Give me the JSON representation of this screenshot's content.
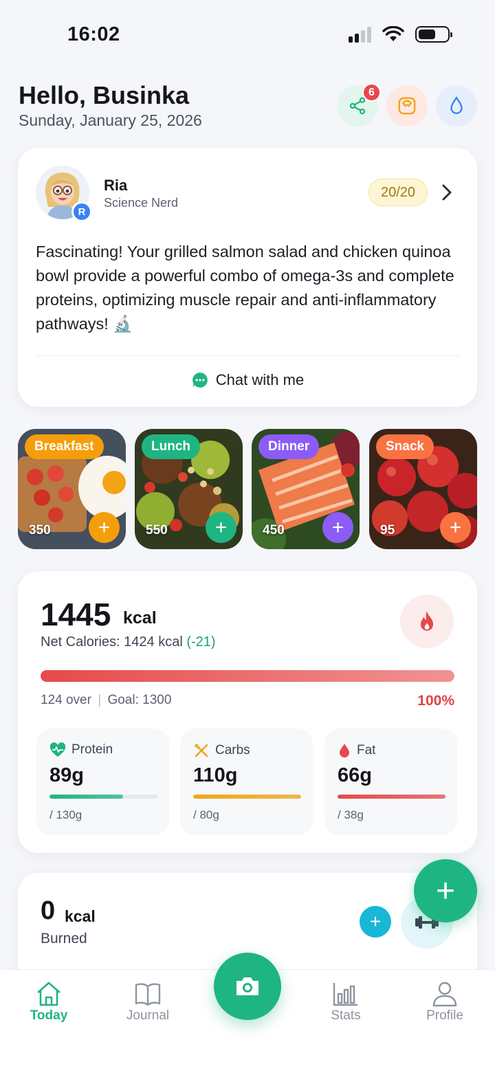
{
  "status": {
    "time": "16:02"
  },
  "header": {
    "greeting": "Hello, Businka",
    "date": "Sunday, January 25, 2026",
    "share_badge": "6"
  },
  "coach": {
    "name": "Ria",
    "role": "Science Nerd",
    "avatar_badge": "R",
    "score": "20/20",
    "message": "Fascinating! Your grilled salmon salad and chicken quinoa bowl provide a powerful combo of omega-3s and complete proteins, optimizing muscle repair and anti-inflammatory pathways! 🔬",
    "chat_label": "Chat with me"
  },
  "meals": [
    {
      "label": "Breakfast",
      "kcal": "350",
      "color": "#f59e0b"
    },
    {
      "label": "Lunch",
      "kcal": "550",
      "color": "#1fb583"
    },
    {
      "label": "Dinner",
      "kcal": "450",
      "color": "#8b5cf6"
    },
    {
      "label": "Snack",
      "kcal": "95",
      "color": "#f97342"
    }
  ],
  "calories": {
    "consumed": "1445",
    "unit": "kcal",
    "net_label": "Net Calories: 1424 kcal",
    "net_diff": "(-21)",
    "over_text": "124 over",
    "goal_text": "Goal: 1300",
    "percent_label": "100%",
    "progress": 1.0
  },
  "macros": [
    {
      "name": "Protein",
      "value": "89g",
      "goal": "/ 130g",
      "progress": 0.68,
      "color": "#1fb583"
    },
    {
      "name": "Carbs",
      "value": "110g",
      "goal": "/ 80g",
      "progress": 1.0,
      "color": "#f2a516"
    },
    {
      "name": "Fat",
      "value": "66g",
      "goal": "/ 38g",
      "progress": 1.0,
      "color": "#e64a4a"
    }
  ],
  "burned": {
    "value": "0",
    "unit": "kcal",
    "label": "Burned"
  },
  "tabs": {
    "today": "Today",
    "journal": "Journal",
    "stats": "Stats",
    "profile": "Profile"
  }
}
